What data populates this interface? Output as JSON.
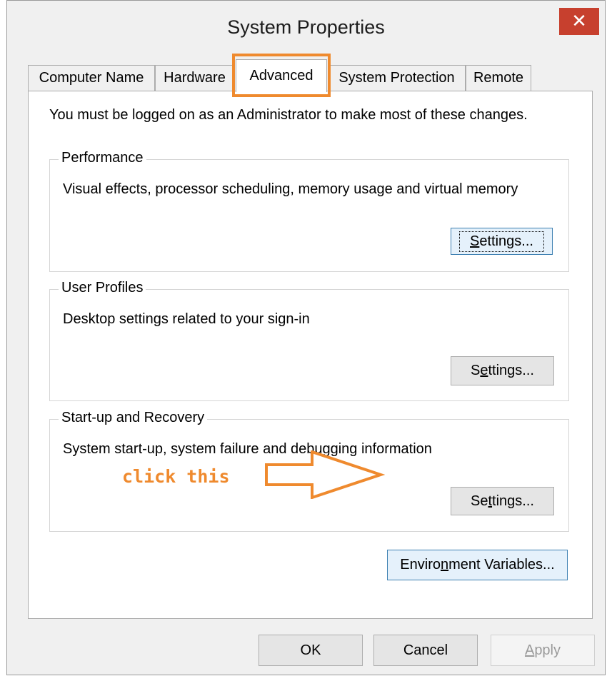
{
  "window": {
    "title": "System Properties",
    "close_glyph": "✕"
  },
  "tabs": [
    {
      "label": "Computer Name",
      "active": false
    },
    {
      "label": "Hardware",
      "active": false
    },
    {
      "label": "Advanced",
      "active": true
    },
    {
      "label": "System Protection",
      "active": false
    },
    {
      "label": "Remote",
      "active": false
    }
  ],
  "admin_note": "You must be logged on as an Administrator to make most of these changes.",
  "groups": {
    "performance": {
      "legend": "Performance",
      "description": "Visual effects, processor scheduling, memory usage and virtual memory",
      "button": {
        "pre": "",
        "accel": "S",
        "post": "ettings..."
      }
    },
    "user_profiles": {
      "legend": "User Profiles",
      "description": "Desktop settings related to your sign-in",
      "button": {
        "pre": "S",
        "accel": "e",
        "post": "ttings..."
      }
    },
    "startup_recovery": {
      "legend": "Start-up and Recovery",
      "description": "System start-up, system failure and debugging information",
      "button": {
        "pre": "Se",
        "accel": "t",
        "post": "tings..."
      }
    }
  },
  "env_button": {
    "pre": "Enviro",
    "accel": "n",
    "post": "ment Variables..."
  },
  "annotation": {
    "text": "click this",
    "color": "#ef8a2e"
  },
  "footer": {
    "ok": "OK",
    "cancel": "Cancel",
    "apply": {
      "pre": "",
      "accel": "A",
      "post": "pply"
    }
  },
  "colors": {
    "highlight": "#ef8a2e",
    "close_button": "#c7402e",
    "focused_button": "#e5f1fb"
  }
}
